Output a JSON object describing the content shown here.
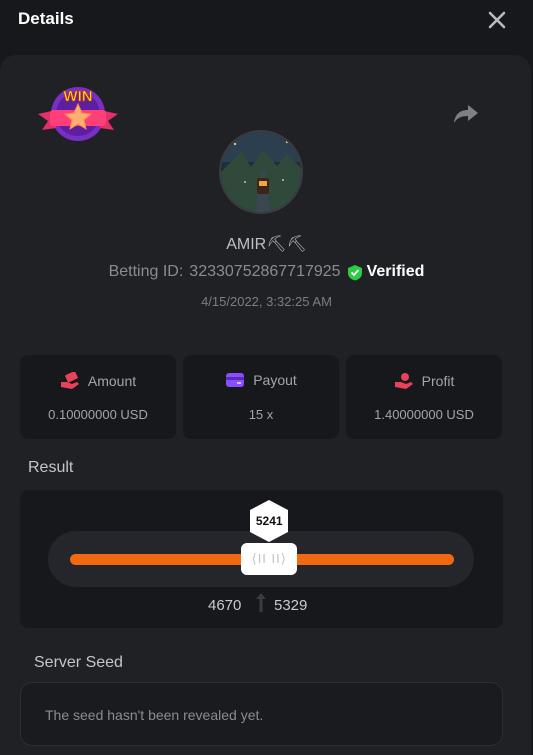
{
  "header": {
    "title": "Details",
    "close_icon": "close-icon"
  },
  "badge": {
    "text": "WIN",
    "icon": "win-star-badge"
  },
  "share_icon": "share-icon",
  "user": {
    "name": "AMIR⛏⛏",
    "betting_id_label": "Betting ID:",
    "betting_id": "323307528677179​25",
    "verified_label": "Verified",
    "date": "4/15/2022, 3:32:25 AM"
  },
  "stats": [
    {
      "label": "Amount",
      "value": "0.10000000 USD",
      "icon": "money-hand-icon",
      "color": "#e8415a"
    },
    {
      "label": "Payout",
      "value": "15 x",
      "icon": "credit-card-icon",
      "color": "#8a4dff"
    },
    {
      "label": "Profit",
      "value": "1.40000000 USD",
      "icon": "hand-money-icon",
      "color": "#e8415a"
    }
  ],
  "result": {
    "label": "Result",
    "value": "5241",
    "fraction": 0.5241,
    "range_low": "4670",
    "range_high": "5329",
    "handle_glyph": "⟨II II⟩",
    "track_color": "#f26a10"
  },
  "server_seed": {
    "label": "Server Seed",
    "text": "The seed hasn't been revealed yet."
  }
}
